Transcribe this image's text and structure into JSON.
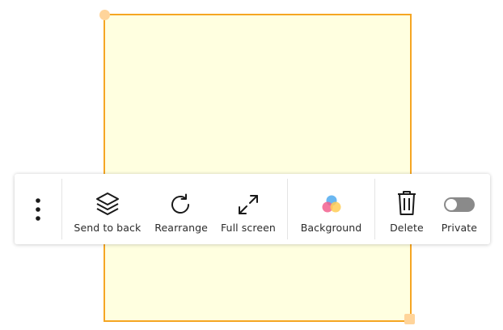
{
  "note": {
    "background_color": "#ffffe0",
    "border_color": "#f5a623"
  },
  "toolbar": {
    "more_icon": "vertical-ellipsis-icon",
    "arrange": [
      {
        "label": "Send to back",
        "icon": "layers-icon"
      },
      {
        "label": "Rearrange",
        "icon": "rotate-icon"
      },
      {
        "label": "Full screen",
        "icon": "expand-icon"
      }
    ],
    "background": {
      "label": "Background",
      "icon": "color-circles-icon"
    },
    "delete": {
      "label": "Delete",
      "icon": "trash-icon"
    },
    "private": {
      "label": "Private",
      "icon": "toggle-icon",
      "enabled": false
    }
  }
}
